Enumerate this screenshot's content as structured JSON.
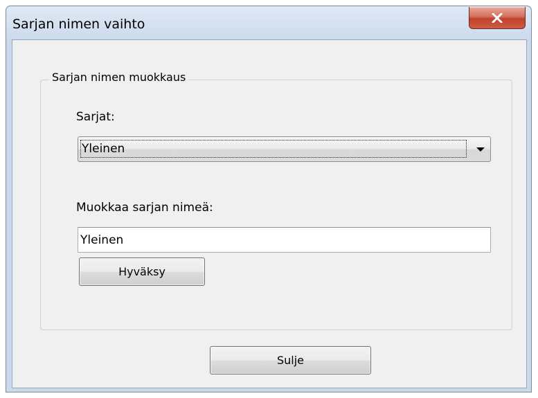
{
  "window": {
    "title": "Sarjan nimen vaihto",
    "close_glyph": "X",
    "close_icon": "close-icon",
    "accent_close_color": "#c7432c"
  },
  "group": {
    "title": "Sarjan nimen muokkaus"
  },
  "series_select": {
    "label": "Sarjat:",
    "selected": "Yleinen",
    "arrow_icon": "chevron-down-icon"
  },
  "rename": {
    "label": "Muokkaa sarjan nimeä:",
    "value": "Yleinen",
    "accept_label": "Hyväksy"
  },
  "footer": {
    "close_label": "Sulje"
  }
}
